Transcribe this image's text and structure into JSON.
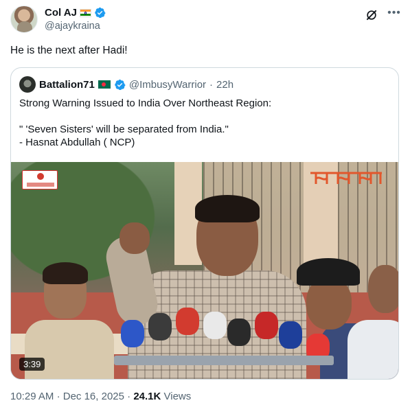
{
  "author": {
    "display_name": "Col AJ",
    "handle": "@ajaykraina",
    "flag": "india-flag",
    "verified_color": "#1d9bf0"
  },
  "post": {
    "text": "He is the next after Hadi!"
  },
  "quoted_post": {
    "display_name": "Battalion71",
    "flag": "bangladesh-flag",
    "handle": "@ImbusyWarrior",
    "separator": "·",
    "time": "22h",
    "lines": [
      "Strong Warning Issued to India Over Northeast Region:",
      "\" 'Seven Sisters' will be separated from India.\"",
      "- Hasnat Abdullah ( NCP)"
    ],
    "video": {
      "duration": "3:39"
    }
  },
  "meta": {
    "time": "10:29 AM",
    "separator_1": "·",
    "date": "Dec 16, 2025",
    "separator_2": "·",
    "views_count": "24.1K",
    "views_label": "Views"
  },
  "icons": {
    "grok": "grok-icon",
    "more": "more-icon",
    "verified": "verified-badge-icon"
  },
  "colors": {
    "text": "#0f1419",
    "secondary": "#536471",
    "border": "#cfd9de",
    "accent": "#1d9bf0"
  }
}
